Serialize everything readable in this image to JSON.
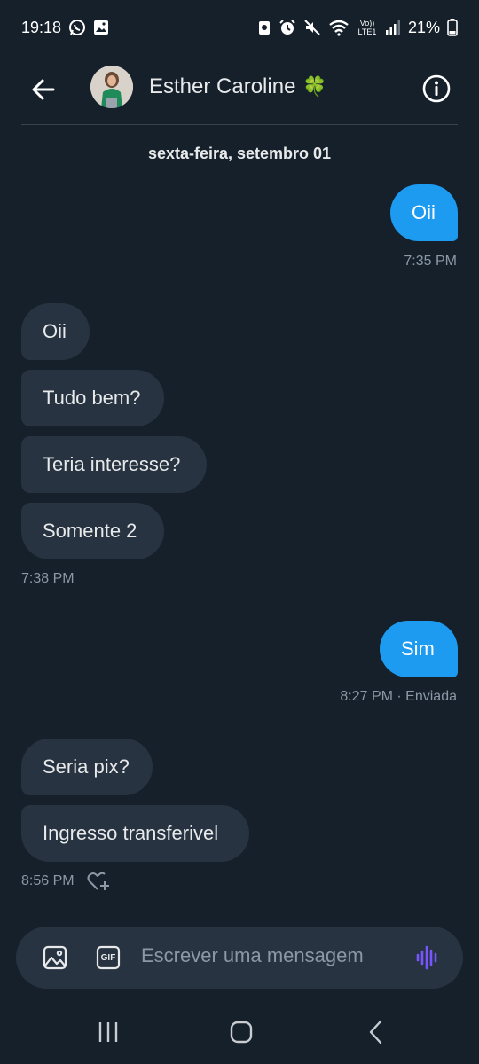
{
  "status_bar": {
    "time": "19:18",
    "battery": "21%",
    "network": "Vo)) LTE1"
  },
  "header": {
    "contact_name": "Esther Caroline",
    "emoji": "🍀"
  },
  "conversation": {
    "date": "sexta-feira, setembro 01",
    "messages": [
      {
        "text": "Oii"
      },
      {
        "text": "Oii"
      },
      {
        "text": "Tudo bem?"
      },
      {
        "text": "Teria interesse?"
      },
      {
        "text": "Somente 2"
      },
      {
        "text": "Sim"
      },
      {
        "text": "Seria pix?"
      },
      {
        "text": "Ingresso transferivel"
      }
    ],
    "meta": {
      "t1": "7:35 PM",
      "t2": "7:38 PM",
      "t3": "8:27 PM · Enviada",
      "t4": "8:56 PM"
    }
  },
  "composer": {
    "placeholder": "Escrever uma mensagem",
    "gif_label": "GIF"
  },
  "colors": {
    "background": "#15202b",
    "sent_bubble": "#1d9bf0",
    "received_bubble": "#273340",
    "voice_icon": "#7856ff"
  }
}
